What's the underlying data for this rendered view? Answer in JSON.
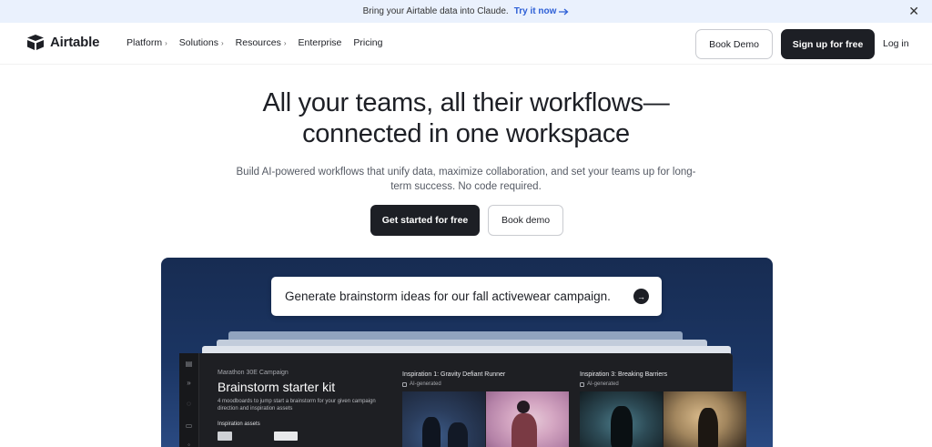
{
  "banner": {
    "text": "Bring your Airtable data into Claude.",
    "cta": "Try it now",
    "cta_icon": "arrow-right-icon",
    "close_icon": "close-icon"
  },
  "nav": {
    "logo_text": "Airtable",
    "items": [
      {
        "label": "Platform",
        "has_chevron": true
      },
      {
        "label": "Solutions",
        "has_chevron": true
      },
      {
        "label": "Resources",
        "has_chevron": true
      },
      {
        "label": "Enterprise",
        "has_chevron": false
      },
      {
        "label": "Pricing",
        "has_chevron": false
      }
    ],
    "chevron": "›",
    "book_demo": "Book Demo",
    "signup": "Sign up for free",
    "login": "Log in"
  },
  "hero": {
    "title_line1": "All your teams, all their workflows—",
    "title_line2": "connected in one workspace",
    "subtitle": "Build AI-powered workflows that unify data, maximize collaboration, and set your teams up for long-term success. No code required.",
    "primary_cta": "Get started for free",
    "secondary_cta": "Book demo"
  },
  "showcase": {
    "prompt": "Generate brainstorm ideas for our fall activewear campaign.",
    "send_icon": "→",
    "app": {
      "eyebrow": "Marathon 30E Campaign",
      "title": "Brainstorm starter kit",
      "description": "4 moodboards to jump start a brainstorm for your given campaign direction and inspiration assets",
      "assets_label": "Inspiration assets",
      "inspirations": [
        {
          "title": "Inspiration 1: Gravity Defiant Runner",
          "tag": "AI-generated"
        },
        {
          "title": "Inspiration 3: Breaking Barriers",
          "tag": "AI-generated"
        }
      ]
    }
  },
  "colors": {
    "brand_dark": "#1d1f25",
    "banner_bg": "#eaf1fd",
    "link_blue": "#2d5fd6",
    "showcase_bg": "#1b3563"
  }
}
